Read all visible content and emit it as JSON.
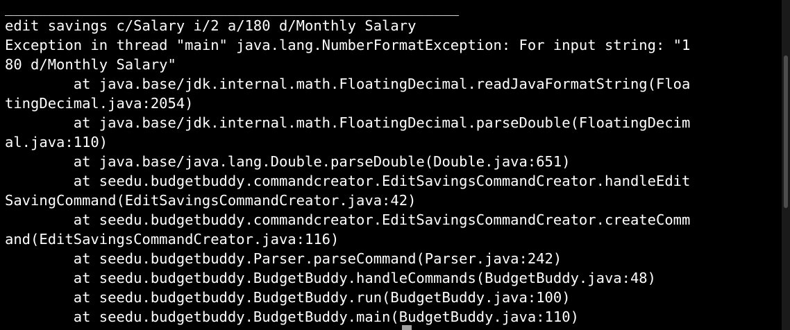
{
  "terminal": {
    "lines": [
      "_____________________________________________________",
      "edit savings c/Salary i/2 a/180 d/Monthly Salary",
      "Exception in thread \"main\" java.lang.NumberFormatException: For input string: \"1",
      "80 d/Monthly Salary\"",
      "        at java.base/jdk.internal.math.FloatingDecimal.readJavaFormatString(Floa",
      "tingDecimal.java:2054)",
      "        at java.base/jdk.internal.math.FloatingDecimal.parseDouble(FloatingDecim",
      "al.java:110)",
      "        at java.base/java.lang.Double.parseDouble(Double.java:651)",
      "        at seedu.budgetbuddy.commandcreator.EditSavingsCommandCreator.handleEdit",
      "SavingCommand(EditSavingsCommandCreator.java:42)",
      "        at seedu.budgetbuddy.commandcreator.EditSavingsCommandCreator.createComm",
      "and(EditSavingsCommandCreator.java:116)",
      "        at seedu.budgetbuddy.Parser.parseCommand(Parser.java:242)",
      "        at seedu.budgetbuddy.BudgetBuddy.handleCommands(BudgetBuddy.java:48)",
      "        at seedu.budgetbuddy.BudgetBuddy.run(BudgetBuddy.java:100)",
      "        at seedu.budgetbuddy.BudgetBuddy.main(BudgetBuddy.java:110)"
    ]
  },
  "colors": {
    "background": "#000000",
    "text": "#ffffff",
    "cursor": "#a0a0a0"
  }
}
